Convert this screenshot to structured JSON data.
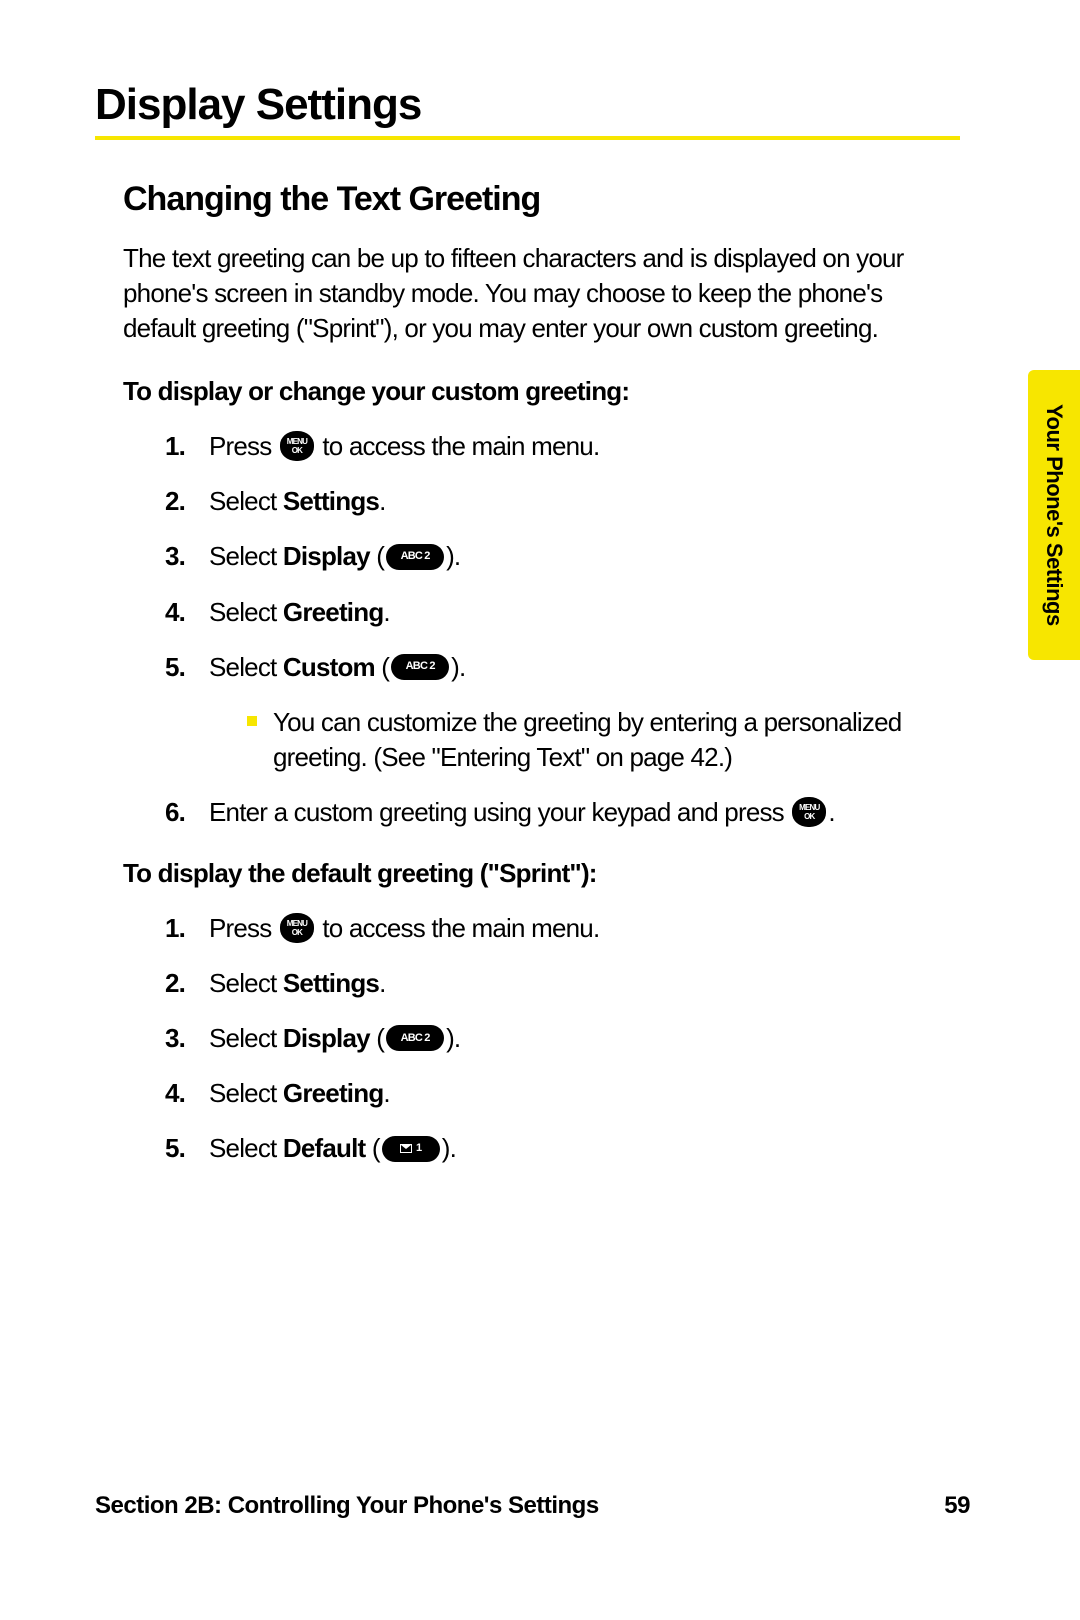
{
  "section_title": "Display Settings",
  "subsection_title": "Changing the Text Greeting",
  "intro": "The text greeting can be up to fifteen characters and is displayed on your phone's screen in standby mode. You may choose to keep the phone's default greeting (\"Sprint\"), or you may enter your own custom greeting.",
  "heading1": "To display or change your custom greeting:",
  "steps1": {
    "s1_pre": "Press ",
    "s1_post": " to access the main menu.",
    "s2_pre": "Select ",
    "s2_bold": "Settings",
    "s2_post": ".",
    "s3_pre": "Select ",
    "s3_bold": "Display",
    "s3_post_open": " (",
    "s3_key": "ABC 2",
    "s3_post_close": ").",
    "s4_pre": "Select ",
    "s4_bold": "Greeting",
    "s4_post": ".",
    "s5_pre": "Select ",
    "s5_bold": "Custom",
    "s5_post_open": " (",
    "s5_key": "ABC 2",
    "s5_post_close": ").",
    "s5_sub": "You can customize the greeting by entering a personalized greeting. (See \"Entering Text\" on page 42.)",
    "s6_pre": "Enter a custom greeting using your keypad and press ",
    "s6_post": "."
  },
  "heading2": "To display the default greeting (\"Sprint\"):",
  "steps2": {
    "s1_pre": "Press ",
    "s1_post": " to access the main menu.",
    "s2_pre": "Select ",
    "s2_bold": "Settings",
    "s2_post": ".",
    "s3_pre": "Select ",
    "s3_bold": "Display",
    "s3_post_open": " (",
    "s3_key": "ABC 2",
    "s3_post_close": ").",
    "s4_pre": "Select ",
    "s4_bold": "Greeting",
    "s4_post": ".",
    "s5_pre": "Select ",
    "s5_bold": "Default",
    "s5_post_open": " (",
    "s5_key": "1",
    "s5_post_close": ")."
  },
  "menu_key_line1": "MENU",
  "menu_key_line2": "OK",
  "side_tab": "Your Phone's Settings",
  "footer_left": "Section 2B: Controlling Your Phone's Settings",
  "footer_right": "59",
  "nums": {
    "n1": "1.",
    "n2": "2.",
    "n3": "3.",
    "n4": "4.",
    "n5": "5.",
    "n6": "6."
  }
}
